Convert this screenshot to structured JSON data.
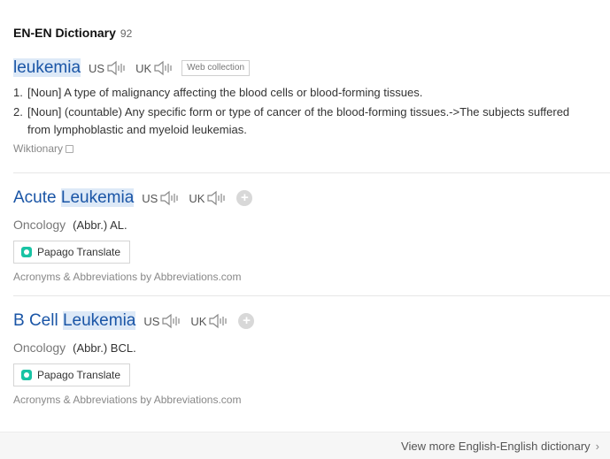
{
  "section": {
    "title": "EN-EN Dictionary",
    "count": "92"
  },
  "entries": [
    {
      "word": "leukemia",
      "us": "US",
      "uk": "UK",
      "badge": "Web collection",
      "meanings": [
        {
          "num": "1.",
          "text": "[Noun] A type of malignancy affecting the blood cells or blood-forming tissues."
        },
        {
          "num": "2.",
          "text": "[Noun] (countable) Any specific form or type of cancer of the blood-forming tissues.->The subjects suffered from lymphoblastic and myeloid leukemias."
        }
      ],
      "source": "Wiktionary"
    },
    {
      "word_prefix": "Acute",
      "word_highlight": "Leukemia",
      "us": "US",
      "uk": "UK",
      "add": "+",
      "field": "Oncology",
      "abbr": "(Abbr.) AL.",
      "translate": "Papago Translate",
      "source": "Acronyms & Abbreviations by Abbreviations.com"
    },
    {
      "word_prefix": "B Cell",
      "word_highlight": "Leukemia",
      "us": "US",
      "uk": "UK",
      "add": "+",
      "field": "Oncology",
      "abbr": "(Abbr.) BCL.",
      "translate": "Papago Translate",
      "source": "Acronyms & Abbreviations by Abbreviations.com"
    }
  ],
  "footer": {
    "more": "View more English-English dictionary",
    "chevron": "›"
  }
}
